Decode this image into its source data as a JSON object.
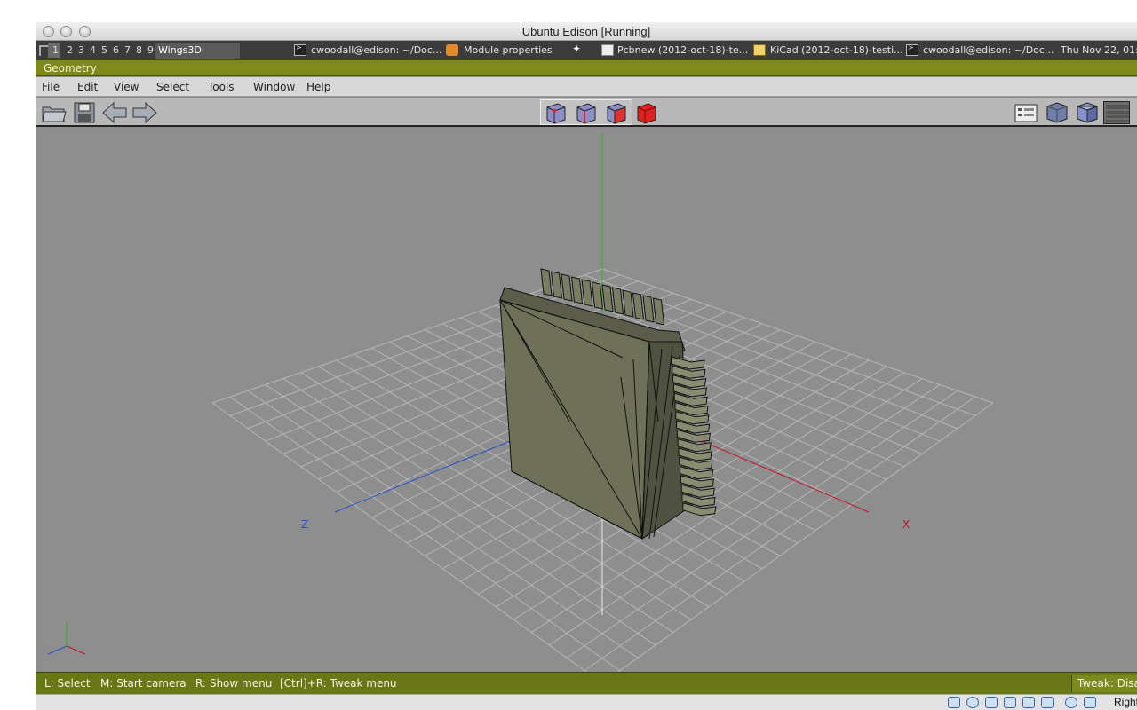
{
  "host_window": {
    "title": "Ubuntu Edison [Running]"
  },
  "taskbar": {
    "workspaces": [
      "1",
      "2",
      "3",
      "4",
      "5",
      "6",
      "7",
      "8",
      "9"
    ],
    "active_app": "Wings3D",
    "tasks": [
      {
        "label": "cwoodall@edison: ~/Doc...",
        "icon": "terminal-icon"
      },
      {
        "label": "Module properties",
        "icon": "module-icon"
      },
      {
        "label": "Pcbnew (2012-oct-18)-te...",
        "icon": "pcbnew-icon"
      },
      {
        "label": "KiCad (2012-oct-18)-testi...",
        "icon": "kicad-icon"
      },
      {
        "label": "cwoodall@edison: ~/Doc...",
        "icon": "terminal-icon"
      }
    ],
    "clock": "Thu Nov 22, 01:"
  },
  "wings": {
    "window_title": "Geometry",
    "menus": [
      "File",
      "Edit",
      "View",
      "Select",
      "Tools",
      "Window",
      "Help"
    ],
    "viewport": {
      "axis_x": "X",
      "axis_z": "Z"
    },
    "status": {
      "left_click": "L: Select",
      "middle_click": "M: Start camera",
      "right_click": "R: Show menu",
      "ctrl_right": "[Ctrl]+R: Tweak menu",
      "tweak": "Tweak: Disa"
    }
  },
  "host_statusbar": {
    "label": "Right ⌘"
  },
  "colors": {
    "title_olive": "#7d8a1a",
    "status_olive": "#697716",
    "viewport_bg": "#8e8e8e",
    "axis_x": "#cc1a2a",
    "axis_y": "#44aa22",
    "axis_z": "#2a55cc"
  }
}
